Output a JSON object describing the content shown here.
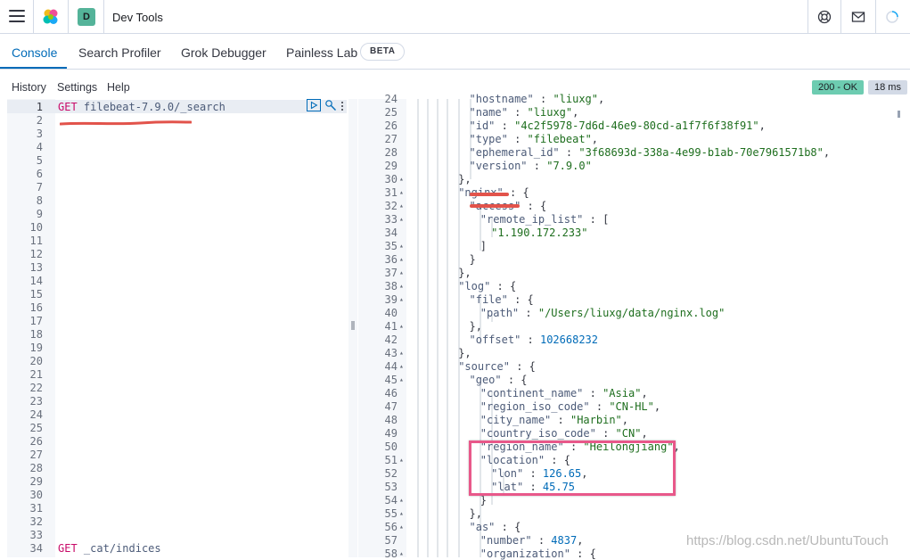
{
  "header": {
    "menu_icon": "hamburger-icon",
    "logo_icon": "elastic-logo-icon",
    "space_initial": "D",
    "title": "Dev Tools",
    "icons": [
      "help-icon",
      "mail-icon",
      "loading-icon"
    ]
  },
  "tabs": [
    {
      "label": "Console",
      "active": true
    },
    {
      "label": "Search Profiler",
      "active": false
    },
    {
      "label": "Grok Debugger",
      "active": false
    },
    {
      "label": "Painless Lab",
      "active": false
    }
  ],
  "beta_badge": "BETA",
  "toolbar": {
    "history": "History",
    "settings": "Settings",
    "help": "Help",
    "status": "200 - OK",
    "time": "18 ms"
  },
  "request_editor": {
    "line_numbers": [
      "1",
      "2",
      "3",
      "4",
      "5",
      "6",
      "7",
      "8",
      "9",
      "10",
      "11",
      "12",
      "13",
      "14",
      "15",
      "16",
      "17",
      "18",
      "19",
      "20",
      "21",
      "22",
      "23",
      "24",
      "25",
      "26",
      "27",
      "28",
      "29",
      "30",
      "31",
      "32",
      "33",
      "34"
    ],
    "line1_method": "GET",
    "line1_path": "filebeat-7.9.0/_search",
    "line34_method": "GET",
    "line34_path": "_cat/indices"
  },
  "response_editor": {
    "lines": [
      {
        "num": "24",
        "fold": false,
        "text": "  \"hostname\" : \"liuxg\","
      },
      {
        "num": "25",
        "fold": false,
        "text": "  \"name\" : \"liuxg\","
      },
      {
        "num": "26",
        "fold": false,
        "text": "  \"id\" : \"4c2f5978-7d6d-46e9-80cd-a1f7f6f38f91\","
      },
      {
        "num": "27",
        "fold": false,
        "text": "  \"type\" : \"filebeat\","
      },
      {
        "num": "28",
        "fold": false,
        "text": "  \"ephemeral_id\" : \"3f68693d-338a-4e99-b1ab-70e7961571b8\","
      },
      {
        "num": "29",
        "fold": false,
        "text": "  \"version\" : \"7.9.0\""
      },
      {
        "num": "30",
        "fold": true,
        "text": "},"
      },
      {
        "num": "31",
        "fold": true,
        "text": "\"nginx\" : {"
      },
      {
        "num": "32",
        "fold": true,
        "text": "  \"access\" : {"
      },
      {
        "num": "33",
        "fold": true,
        "text": "    \"remote_ip_list\" : ["
      },
      {
        "num": "34",
        "fold": false,
        "text": "      \"1.190.172.233\""
      },
      {
        "num": "35",
        "fold": true,
        "text": "    ]"
      },
      {
        "num": "36",
        "fold": true,
        "text": "  }"
      },
      {
        "num": "37",
        "fold": true,
        "text": "},"
      },
      {
        "num": "38",
        "fold": true,
        "text": "\"log\" : {"
      },
      {
        "num": "39",
        "fold": true,
        "text": "  \"file\" : {"
      },
      {
        "num": "40",
        "fold": false,
        "text": "    \"path\" : \"/Users/liuxg/data/nginx.log\""
      },
      {
        "num": "41",
        "fold": true,
        "text": "  },"
      },
      {
        "num": "42",
        "fold": false,
        "text": "  \"offset\" : 102668232"
      },
      {
        "num": "43",
        "fold": true,
        "text": "},"
      },
      {
        "num": "44",
        "fold": true,
        "text": "\"source\" : {"
      },
      {
        "num": "45",
        "fold": true,
        "text": "  \"geo\" : {"
      },
      {
        "num": "46",
        "fold": false,
        "text": "    \"continent_name\" : \"Asia\","
      },
      {
        "num": "47",
        "fold": false,
        "text": "    \"region_iso_code\" : \"CN-HL\","
      },
      {
        "num": "48",
        "fold": false,
        "text": "    \"city_name\" : \"Harbin\","
      },
      {
        "num": "49",
        "fold": false,
        "text": "    \"country_iso_code\" : \"CN\","
      },
      {
        "num": "50",
        "fold": false,
        "text": "    \"region_name\" : \"Heilongjiang\","
      },
      {
        "num": "51",
        "fold": true,
        "text": "    \"location\" : {"
      },
      {
        "num": "52",
        "fold": false,
        "text": "      \"lon\" : 126.65,"
      },
      {
        "num": "53",
        "fold": false,
        "text": "      \"lat\" : 45.75"
      },
      {
        "num": "54",
        "fold": true,
        "text": "    }"
      },
      {
        "num": "55",
        "fold": true,
        "text": "  },"
      },
      {
        "num": "56",
        "fold": true,
        "text": "  \"as\" : {"
      },
      {
        "num": "57",
        "fold": false,
        "text": "    \"number\" : 4837,"
      },
      {
        "num": "58",
        "fold": true,
        "text": "    \"organization\" : {"
      }
    ]
  },
  "watermark": "https://blog.csdn.net/UbuntuTouch",
  "colors": {
    "accent": "#006bb8",
    "status_ok": "#6dccb1",
    "highlight": "#e8588a",
    "annotation_red": "#e2534b"
  }
}
